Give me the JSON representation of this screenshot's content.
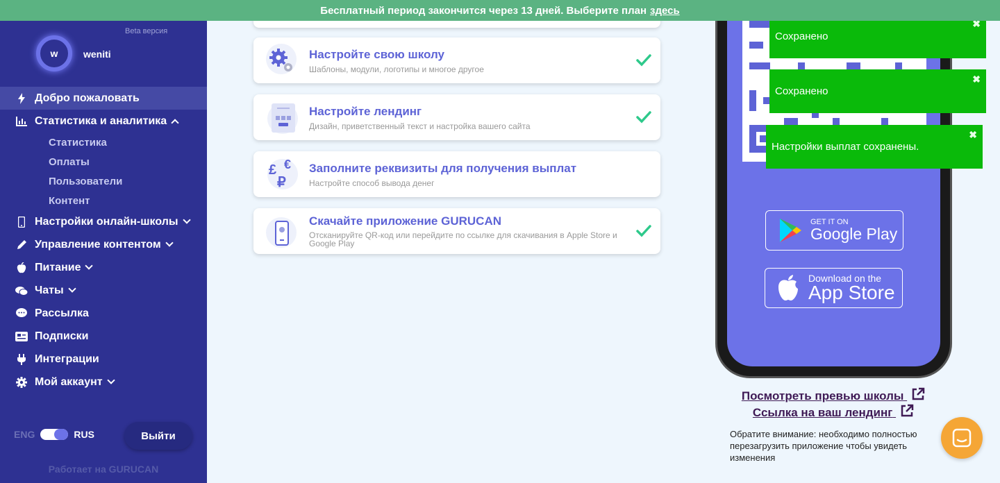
{
  "banner": {
    "text": "Бесплатный период закончится через 13 дней. Выберите план",
    "link": "здесь"
  },
  "sidebar": {
    "beta": "Beta версия",
    "avatar_letter": "w",
    "username": "weniti",
    "items": [
      {
        "label": "Добро пожаловать",
        "icon": "bolt-icon"
      },
      {
        "label": "Статистика и аналитика",
        "icon": "chart-icon"
      },
      {
        "label": "Настройки онлайн-школы",
        "icon": "phone-icon"
      },
      {
        "label": "Управление контентом",
        "icon": "pencil-icon"
      },
      {
        "label": "Питание",
        "icon": "apple-icon"
      },
      {
        "label": "Чаты",
        "icon": "chats-icon"
      },
      {
        "label": "Рассылка",
        "icon": "comment-icon"
      },
      {
        "label": "Подписки",
        "icon": "card-icon"
      },
      {
        "label": "Интеграции",
        "icon": "plug-icon"
      },
      {
        "label": "Мой аккаунт",
        "icon": "gear-icon"
      }
    ],
    "sub_items": [
      "Статистика",
      "Оплаты",
      "Пользователи",
      "Контент"
    ],
    "lang_eng": "ENG",
    "lang_rus": "RUS",
    "logout": "Выйти",
    "powered": "Работает на GURUCAN"
  },
  "cards": [
    {
      "title": "Настройте свою школу",
      "desc": "Шаблоны, модули, логотипы и многое другое",
      "done": true
    },
    {
      "title": "Настройте лендинг",
      "desc": "Дизайн, приветственный текст и настройка вашего сайта",
      "done": true
    },
    {
      "title": "Заполните реквизиты для получения выплат",
      "desc": "Настройте способ вывода денег",
      "done": false
    },
    {
      "title": "Скачайте приложение GURUCAN",
      "desc": "Отсканируйте QR-код или перейдите по ссылке для скачивания в Apple Store и Google Play",
      "done": true
    }
  ],
  "phone": {
    "google_small": "GET IT ON",
    "google_big": "Google Play",
    "apple_small": "Download on the",
    "apple_big": "App Store"
  },
  "links": {
    "preview": "Посмотреть превью школы",
    "landing": "Ссылка на ваш лендинг"
  },
  "note": "Обратите внимание: необходимо полностью перезагрузить приложение чтобы увидеть изменения",
  "toasts": [
    {
      "text": "Сохранено",
      "close": "✖"
    },
    {
      "text": "Сохранено",
      "close": "✖"
    },
    {
      "text": "Настройки выплат сохранены.",
      "close": "✖"
    }
  ],
  "colors": {
    "sidebar": "#2e3192",
    "accent": "#5d63d6",
    "banner": "#5bb382",
    "toast": "#0aba0a",
    "check": "#2ec98b",
    "chat": "#f5a636"
  }
}
